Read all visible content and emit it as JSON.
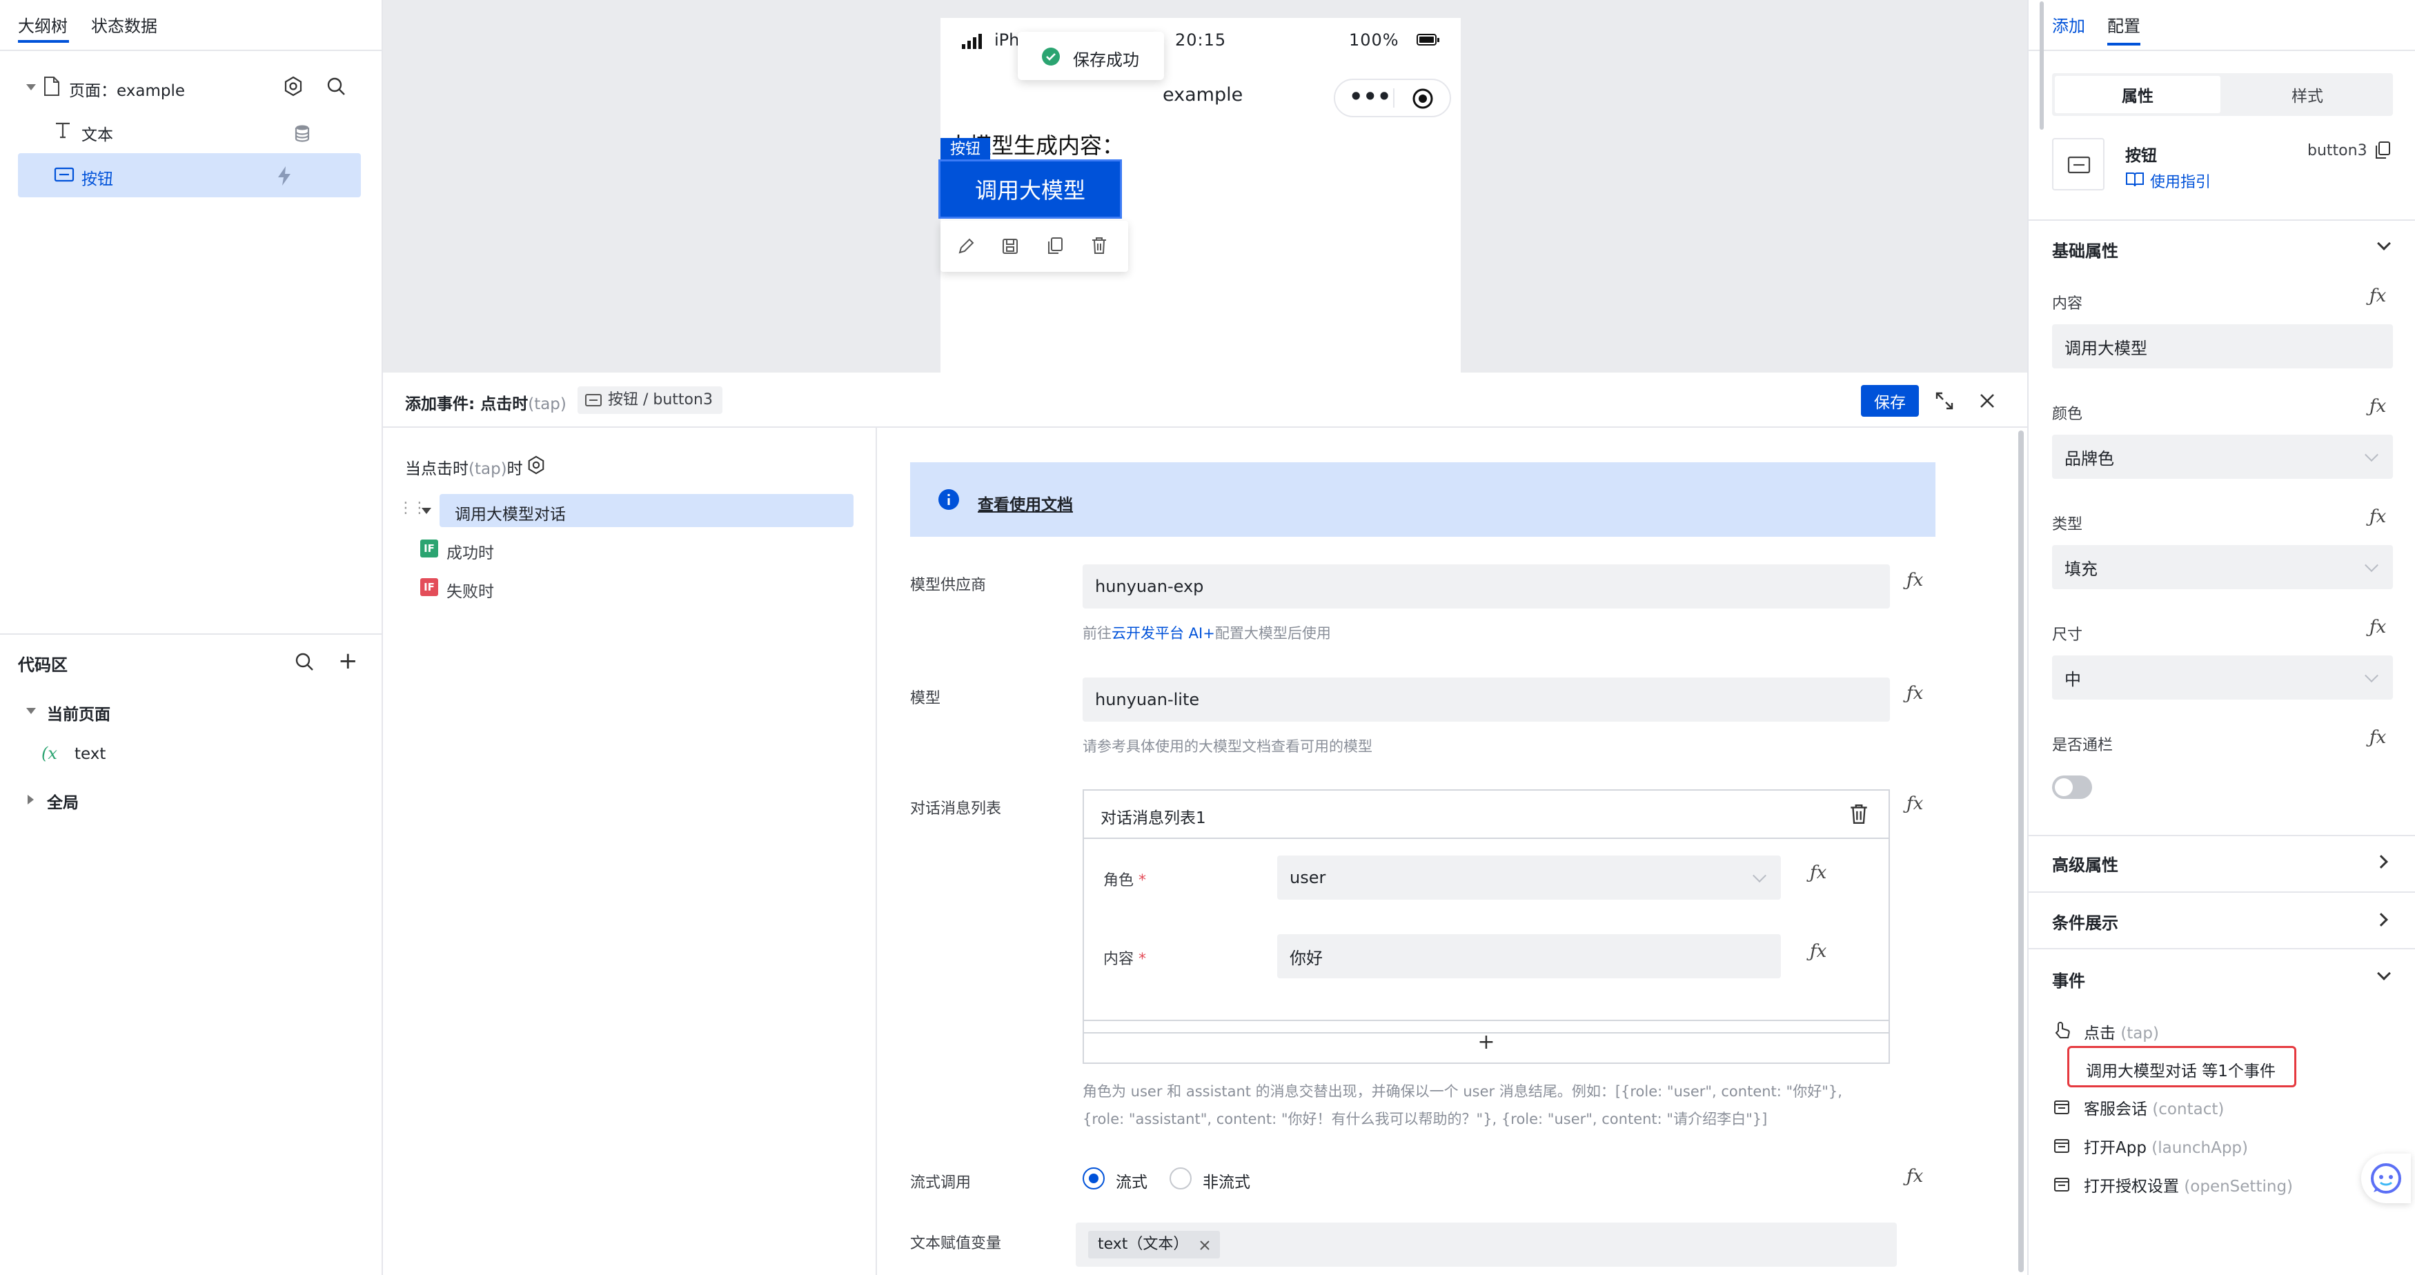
{
  "left_panel": {
    "tabs": [
      "大纲树",
      "状态数据"
    ],
    "tree": {
      "page_label": "页面：example",
      "items": [
        {
          "label": "文本"
        },
        {
          "label": "按钮"
        }
      ]
    },
    "code_area": {
      "title": "代码区",
      "groups": [
        {
          "label": "当前页面",
          "children": [
            {
              "label": "text"
            }
          ]
        },
        {
          "label": "全局"
        }
      ]
    }
  },
  "preview": {
    "status_bar": {
      "carrier": "iPh",
      "time": "20:15",
      "battery": "100%"
    },
    "toast": "保存成功",
    "nav_title": "example",
    "content_text": "大模型生成内容：",
    "button_tag": "按钮",
    "button_label": "调用大模型"
  },
  "event_editor": {
    "title": "添加事件: 点击时",
    "title_suffix": "(tap)",
    "component_path": "按钮 / button3",
    "save_label": "保存",
    "trigger_label": "当点击时",
    "trigger_suffix": "(tap)",
    "trigger_tail": "时",
    "actions": [
      {
        "label": "调用大模型对话"
      },
      {
        "label": "成功时",
        "badge": "IF"
      },
      {
        "label": "失败时",
        "badge": "IF"
      }
    ],
    "doc_banner": "查看使用文档",
    "form": {
      "provider": {
        "label": "模型供应商",
        "value": "hunyuan-exp",
        "hint_prefix": "前往",
        "hint_link": "云开发平台 AI+",
        "hint_suffix": "配置大模型后使用"
      },
      "model": {
        "label": "模型",
        "value": "hunyuan-lite",
        "hint": "请参考具体使用的大模型文档查看可用的模型"
      },
      "messages": {
        "label": "对话消息列表",
        "card_title": "对话消息列表1",
        "role_label": "角色",
        "role_value": "user",
        "content_label": "内容",
        "content_value": "你好",
        "add_label": "+",
        "hint_line1": "角色为 user 和 assistant 的消息交替出现，并确保以一个 user 消息结尾。例如：[{role: \"user\", content: \"你好\"},",
        "hint_line2": "{role: \"assistant\", content: \"你好！有什么我可以帮助的？\"}, {role: \"user\", content: \"请介绍李白\"}]"
      },
      "stream": {
        "label": "流式调用",
        "options": [
          "流式",
          "非流式"
        ],
        "selected": "流式"
      },
      "assign": {
        "label": "文本赋值变量",
        "tag": "text（文本）"
      }
    }
  },
  "right_panel": {
    "tabs": [
      "添加",
      "配置"
    ],
    "active_tab": "配置",
    "segments": [
      "属性",
      "样式"
    ],
    "component": {
      "name": "按钮",
      "id": "button3",
      "guide": "使用指引"
    },
    "basic": {
      "title": "基础属性",
      "fields": [
        {
          "label": "内容",
          "value": "调用大模型"
        },
        {
          "label": "颜色",
          "value": "品牌色"
        },
        {
          "label": "类型",
          "value": "填充"
        },
        {
          "label": "尺寸",
          "value": "中"
        },
        {
          "label": "是否通栏"
        }
      ]
    },
    "advanced": "高级属性",
    "conditional": "条件展示",
    "events": {
      "title": "事件",
      "items": [
        {
          "label": "点击",
          "sub": "(tap)",
          "highlight": "调用大模型对话 等1个事件"
        },
        {
          "label": "客服会话",
          "sub": "(contact)"
        },
        {
          "label": "打开App",
          "sub": "(launchApp)"
        },
        {
          "label": "打开授权设置",
          "sub": "(openSetting)"
        }
      ]
    }
  },
  "colors": {
    "brand": "#0052d9",
    "highlight_border": "#e5393f",
    "success": "#2ba471",
    "if_green": "#2ba471",
    "if_red": "#e34d59"
  }
}
